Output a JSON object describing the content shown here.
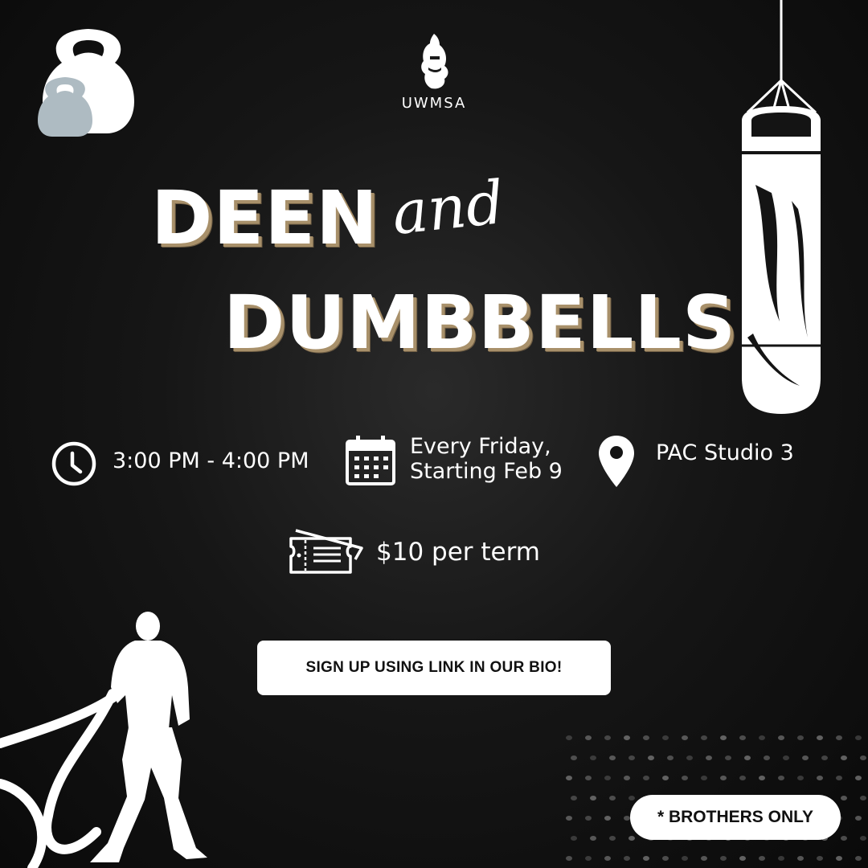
{
  "logo": {
    "text": "UWMSA"
  },
  "title": {
    "line1": "DEEN",
    "connector": "and",
    "line2": "DUMBBELLS"
  },
  "details": {
    "time": "3:00 PM - 4:00 PM",
    "date_line1": "Every Friday,",
    "date_line2": "Starting Feb 9",
    "location": "PAC Studio 3",
    "price": "$10 per term"
  },
  "cta": {
    "label": "SIGN UP USING LINK IN OUR BIO!"
  },
  "badge": {
    "label": "* BROTHERS ONLY"
  },
  "colors": {
    "title_shadow": "#a8906a",
    "kettlebell_small": "#aebbc2",
    "background": "#141414"
  },
  "icons": [
    "kettlebell-icon",
    "punching-bag-icon",
    "clock-icon",
    "calendar-icon",
    "location-pin-icon",
    "ticket-icon",
    "battle-rope-athlete-icon"
  ]
}
